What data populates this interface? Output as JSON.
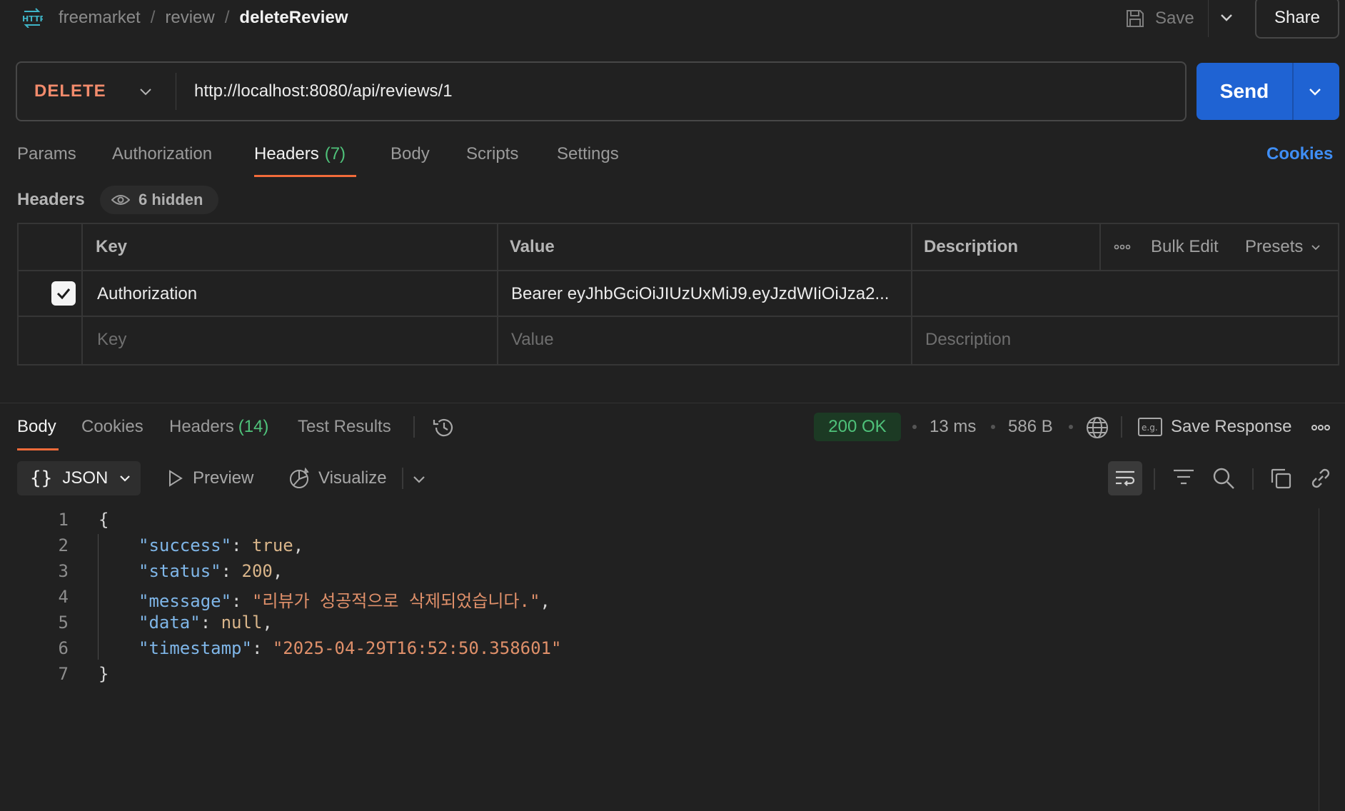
{
  "breadcrumb": {
    "icon": "http-icon",
    "items": [
      "freemarket",
      "review"
    ],
    "separator": "/",
    "current": "deleteReview"
  },
  "toolbar": {
    "save_label": "Save",
    "share_label": "Share"
  },
  "request": {
    "method": "DELETE",
    "url": "http://localhost:8080/api/reviews/1",
    "send_label": "Send"
  },
  "request_tabs": [
    {
      "label": "Params"
    },
    {
      "label": "Authorization"
    },
    {
      "label": "Headers",
      "count": "(7)"
    },
    {
      "label": "Body"
    },
    {
      "label": "Scripts"
    },
    {
      "label": "Settings"
    }
  ],
  "cookies_link": "Cookies",
  "headers_section": {
    "title": "Headers",
    "hidden_label": "6 hidden",
    "columns": [
      "Key",
      "Value",
      "Description"
    ],
    "bulk_edit": "Bulk Edit",
    "presets": "Presets",
    "rows": [
      {
        "checked": true,
        "key": "Authorization",
        "value": "Bearer eyJhbGciOiJIUzUxMiJ9.eyJzdWIiOiJza2...",
        "description": ""
      }
    ],
    "placeholders": {
      "key": "Key",
      "value": "Value",
      "description": "Description"
    }
  },
  "response_tabs": [
    {
      "label": "Body"
    },
    {
      "label": "Cookies"
    },
    {
      "label": "Headers",
      "count": "(14)"
    },
    {
      "label": "Test Results"
    }
  ],
  "response_meta": {
    "status": "200 OK",
    "time": "13 ms",
    "size": "586 B",
    "save_response": "Save Response"
  },
  "body_toolbar": {
    "format": "JSON",
    "preview": "Preview",
    "visualize": "Visualize"
  },
  "code_lines": [
    {
      "n": "1"
    },
    {
      "n": "2",
      "key": "\"success\"",
      "val": "true"
    },
    {
      "n": "3",
      "key": "\"status\"",
      "val": "200"
    },
    {
      "n": "4",
      "key": "\"message\"",
      "val": "\"리뷰가 성공적으로 삭제되었습니다.\""
    },
    {
      "n": "5",
      "key": "\"data\"",
      "val": "null"
    },
    {
      "n": "6",
      "key": "\"timestamp\"",
      "val": "\"2025-04-29T16:52:50.358601\""
    },
    {
      "n": "7"
    }
  ],
  "colors": {
    "method": "#f28b6c",
    "send": "#1f63d3",
    "tab_underline": "#f26b3a",
    "success": "#4fc27a",
    "link": "#3f8ef5"
  }
}
